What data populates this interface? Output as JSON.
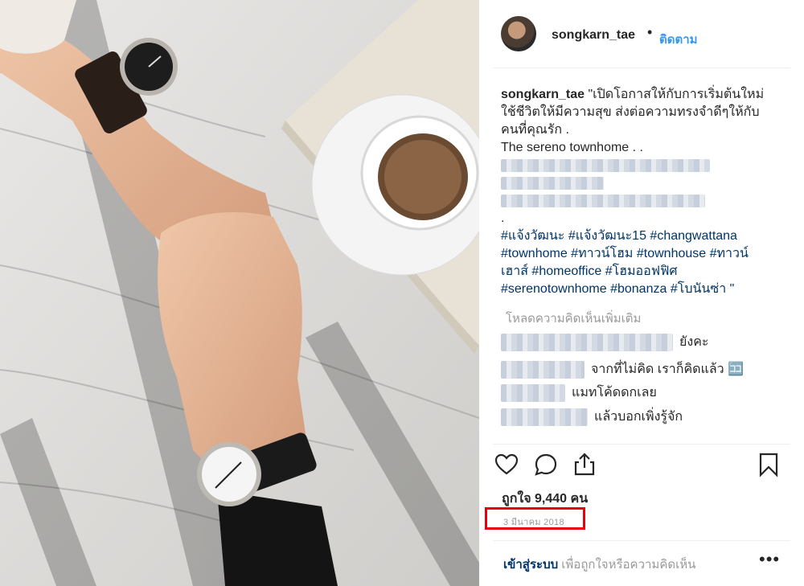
{
  "header": {
    "username": "songkarn_tae",
    "dot": "•",
    "follow": "ติดตาม"
  },
  "caption": {
    "username": "songkarn_tae",
    "lines": [
      "\"เปิดโอกาสให้กับการเริ่มต้นใหม่",
      "ใช้ชีวิตให้มีความสุข ส่งต่อความทรงจำดีๆให้กับ",
      "คนที่คุณรัก .",
      "The sereno townhome . .",
      "."
    ],
    "hashtags": [
      "#แจ้งวัฒนะ #แจ้งวัฒนะ15 #changwattana",
      "#townhome #ทาวน์โฮม #townhouse #ทาวน์",
      "เฮาส์ #homeoffice #โฮมออฟฟิศ",
      "#serenotownhome #bonanza #โบนันซ่า \""
    ]
  },
  "load_more": "โหลดความคิดเห็นเพิ่มเติม",
  "comments": [
    {
      "text": "ยังคะ"
    },
    {
      "text": "จากที่ไม่คิด เราก็คิดแล้ว 🈁"
    },
    {
      "text": "แมทโค้ดดกเลย"
    },
    {
      "text": "แล้วบอกเพิ่งรู้จัก"
    }
  ],
  "actions": {
    "icons": [
      "heart-icon",
      "comment-icon",
      "share-icon",
      "bookmark-icon"
    ]
  },
  "likes": "ถูกใจ 9,440 คน",
  "date": "3 มีนาคม 2018",
  "footer": {
    "login": "เข้าสู่ระบบ",
    "prompt": "เพื่อถูกใจหรือความคิดเห็น",
    "more": "•••"
  },
  "colors": {
    "link": "#3897f0",
    "hashtag": "#003569",
    "muted": "#999999",
    "highlight": "#e8000b"
  }
}
